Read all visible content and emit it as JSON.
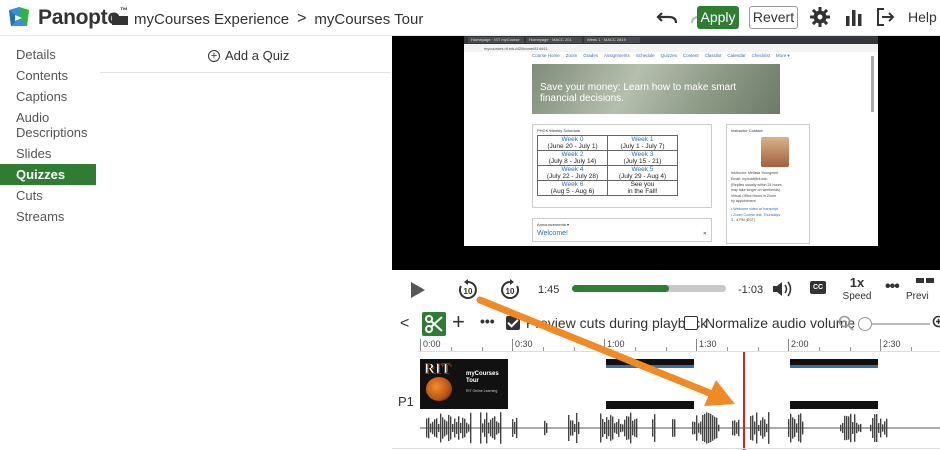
{
  "header": {
    "brand": "Panopto",
    "breadcrumb": [
      "myCourses Experience",
      "myCourses Tour"
    ],
    "apply_label": "Apply",
    "revert_label": "Revert",
    "help_label": "Help ▾"
  },
  "sidebar": {
    "items": [
      {
        "label": "Details"
      },
      {
        "label": "Contents"
      },
      {
        "label": "Captions"
      },
      {
        "label": "Audio Descriptions"
      },
      {
        "label": "Slides"
      },
      {
        "label": "Quizzes",
        "active": true
      },
      {
        "label": "Cuts"
      },
      {
        "label": "Streams"
      }
    ]
  },
  "quiz_panel": {
    "add_label": "Add a Quiz"
  },
  "video": {
    "tabs": [
      "Homepage · IST myCourse",
      "Homepage · MACC 201",
      "Week 1 · MACC 2819"
    ],
    "url": "mycourses.rit.edu/d2l/home/814441",
    "nav": [
      "Course Home",
      "Zoom",
      "Grades",
      "Assignments",
      "Schedule",
      "Quizzes",
      "Content",
      "Classlist",
      "Calendar",
      "Checklist",
      "More ▾"
    ],
    "banner": "Save your money: Learn how to make smart financial decisions.",
    "schedule_title": "PHCK Weekly Schedule",
    "schedule": [
      [
        {
          "wk": "Week 0",
          "dates": "(June 20 - July 1)"
        },
        {
          "wk": "Week 1",
          "dates": "(July 1 - July 7)"
        }
      ],
      [
        {
          "wk": "Week 2",
          "dates": "(July 8 - July 14)"
        },
        {
          "wk": "Week 3",
          "dates": "(July 15 - 21)"
        }
      ],
      [
        {
          "wk": "Week 4",
          "dates": "(July 22 - July 28)"
        },
        {
          "wk": "Week 5",
          "dates": "(July 29 - Aug 4)"
        }
      ],
      [
        {
          "wk": "Week 6",
          "dates": "(Aug 5 - Aug 6)"
        },
        {
          "wk": "See you",
          "dates": "in the Fall!"
        }
      ]
    ],
    "contact_title": "Instructor Contact",
    "contact_lines": [
      "Instructor: Melissa Youngmee",
      "Email: myrcdd@rit.edu",
      "(Replies usually within 24 hours",
      "may take longer on weekends)",
      "Virtual Office Hours in Zoom",
      "by appointment",
      "• Welcome video w/ transcript",
      "• Zoom Course link: Thursdays",
      "3 - 4 PM (EST)"
    ],
    "announcements_title": "Announcements ▾",
    "announcement": "Welcome!"
  },
  "player": {
    "current_time": "1:45",
    "remaining_time": "-1:03",
    "progress": 0.63,
    "speed": "1x",
    "speed_label": "Speed",
    "cc_label": "CC",
    "preview_label": "Previ"
  },
  "edit_toolbar": {
    "preview_cuts_label": "Preview cuts during playback",
    "preview_cuts_checked": true,
    "normalize_label": "Normalize audio volume",
    "normalize_checked": false
  },
  "timeline": {
    "ticks": [
      "0:00",
      "0:30",
      "1:00",
      "1:30",
      "2:00",
      "2:30"
    ],
    "track_label": "P1",
    "title_card": {
      "logo": "RIT",
      "title": "myCourses Tour",
      "sub": "RIT Online Learning"
    }
  },
  "colors": {
    "accent": "#2e7d32",
    "playhead": "#c62828",
    "arrow": "#f08a24"
  }
}
